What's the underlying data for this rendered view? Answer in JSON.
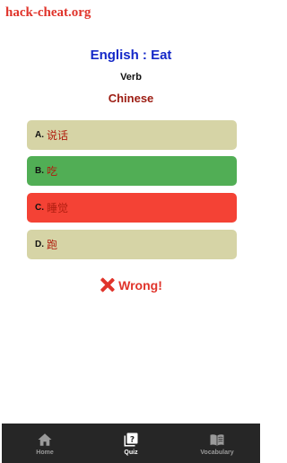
{
  "watermark": "hack-cheat.org",
  "quiz": {
    "title": "English : Eat",
    "word_type": "Verb",
    "target_language": "Chinese"
  },
  "options": [
    {
      "letter": "A.",
      "text": "说话",
      "state": "neutral",
      "color": "#d6d4a6"
    },
    {
      "letter": "B.",
      "text": "吃",
      "state": "correct",
      "color": "#51ae55"
    },
    {
      "letter": "C.",
      "text": "睡觉",
      "state": "wrong",
      "color": "#f44235"
    },
    {
      "letter": "D.",
      "text": "跑",
      "state": "neutral",
      "color": "#d6d4a6"
    }
  ],
  "feedback": {
    "icon": "cross-mark-icon",
    "text": "Wrong!"
  },
  "bottom_nav": {
    "items": [
      {
        "label": "Home",
        "icon": "home-icon",
        "active": false
      },
      {
        "label": "Quiz",
        "icon": "quiz-icon",
        "active": true
      },
      {
        "label": "Vocabulary",
        "icon": "book-icon",
        "active": false
      }
    ]
  },
  "colors": {
    "title": "#1428c8",
    "language": "#9c1c12",
    "wrong": "#e0342b",
    "nav_background": "#262626"
  }
}
